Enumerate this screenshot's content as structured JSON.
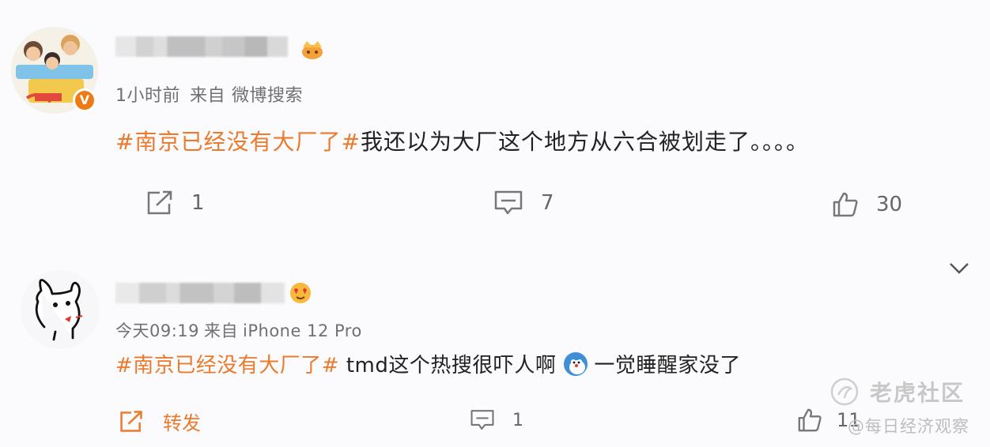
{
  "post1": {
    "meta": {
      "time": "1小时前",
      "source_prefix": "来自",
      "source": "微博搜索"
    },
    "hashtag": "#南京已经没有大厂了#",
    "text": "我还以为大厂这个地方从六合被划走了。。。。",
    "actions": {
      "repost_count": "1",
      "comment_count": "7",
      "like_count": "30"
    },
    "colors": {
      "hashtag": "#ec7a2c",
      "verified_badge": "#ee7a16"
    }
  },
  "post2": {
    "meta": {
      "time": "今天09:19",
      "source_prefix": "来自",
      "source": "iPhone 12 Pro"
    },
    "hashtag": "#南京已经没有大厂了#",
    "text_before": " tmd这个热搜很吓人啊",
    "text_after": "一觉睡醒家没了",
    "actions": {
      "repost_label": "转发",
      "comment_count": "1",
      "like_count": "11"
    }
  },
  "watermarks": {
    "tiger": "老虎社区",
    "nbd": "@每日经济观察"
  },
  "icons": [
    "repost-icon",
    "comment-icon",
    "like-icon",
    "chevron-down-icon",
    "crown-emoji-icon",
    "heart-eyes-emoji-icon",
    "doge-emoji-icon",
    "verified-badge-icon"
  ]
}
